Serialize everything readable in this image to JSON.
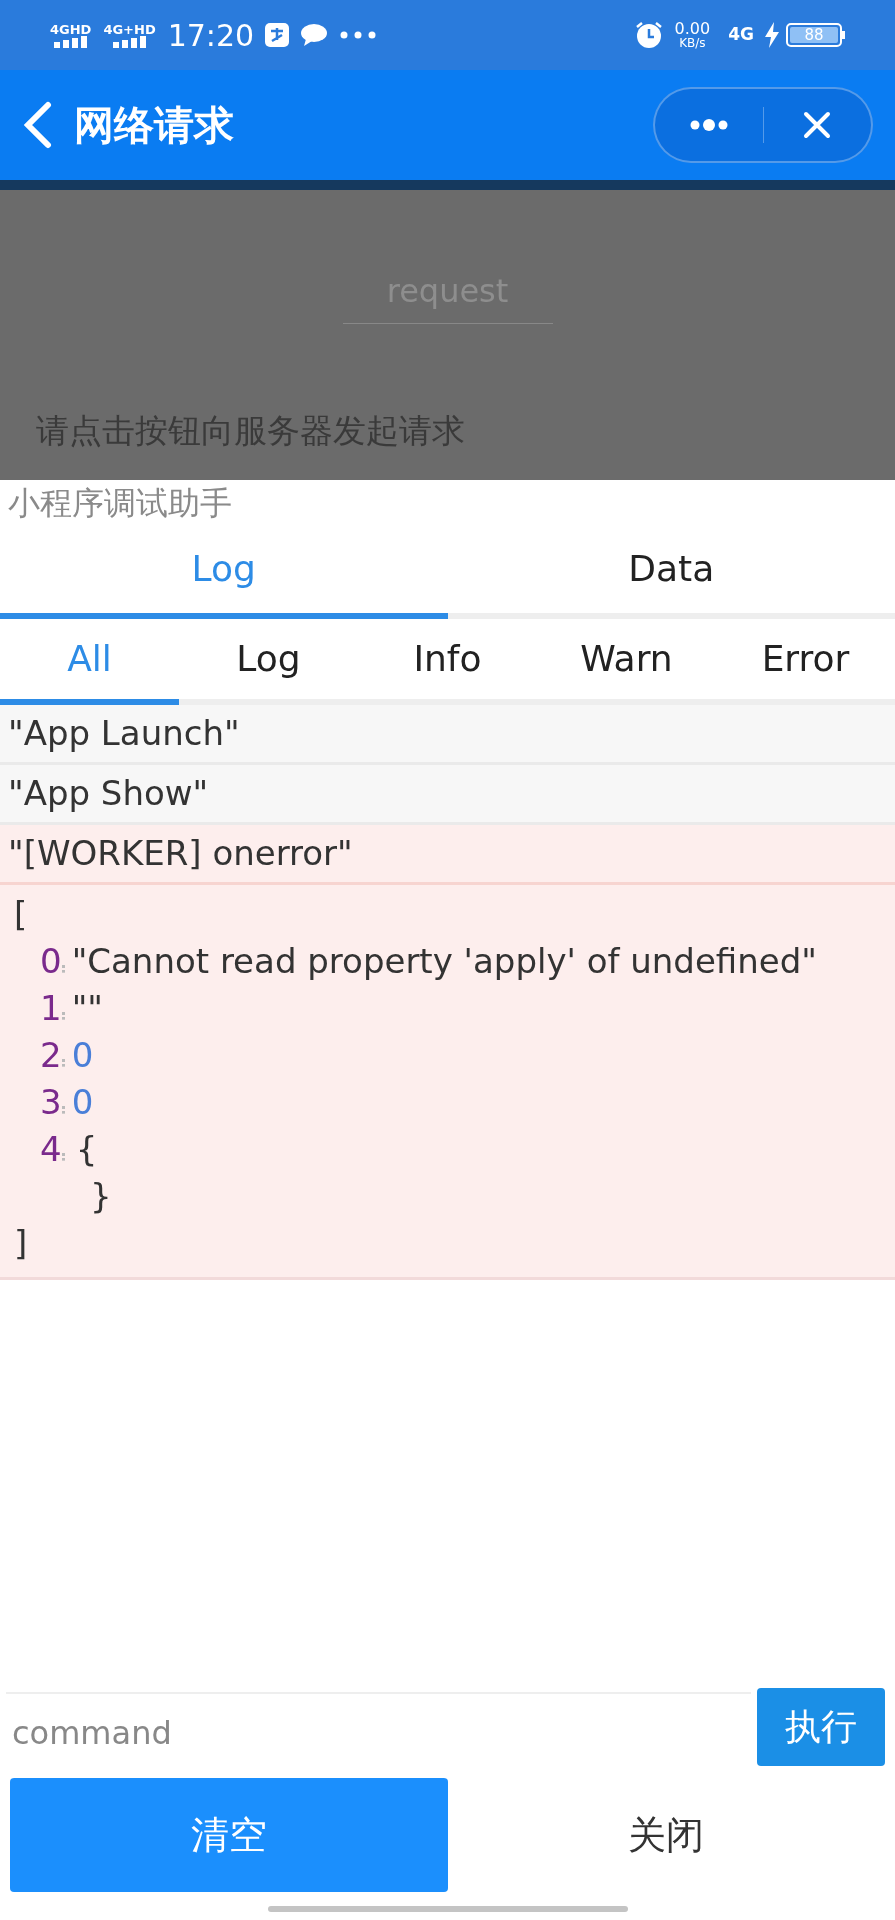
{
  "status_bar": {
    "network_1": "4GHD",
    "network_2": "4G+HD",
    "time": "17:20",
    "speed_value": "0.00",
    "speed_unit": "KB/s",
    "mobile_data": "4G",
    "battery": "88"
  },
  "nav_bar": {
    "title": "网络请求"
  },
  "page": {
    "request_button": "request",
    "hint": "请点击按钮向服务器发起请求"
  },
  "debug_panel": {
    "title": "小程序调试助手",
    "tabs": [
      {
        "label": "Log",
        "selected": true
      },
      {
        "label": "Data",
        "selected": false
      }
    ],
    "filters": [
      {
        "label": "All",
        "selected": true
      },
      {
        "label": "Log",
        "selected": false
      },
      {
        "label": "Info",
        "selected": false
      },
      {
        "label": "Warn",
        "selected": false
      },
      {
        "label": "Error",
        "selected": false
      }
    ],
    "entries": [
      {
        "kind": "log",
        "text": "\"App Launch\""
      },
      {
        "kind": "log",
        "text": "\"App Show\""
      },
      {
        "kind": "error",
        "text": "\"[WORKER] onerror\""
      },
      {
        "kind": "tree",
        "open": "[",
        "close": "]",
        "items": [
          {
            "key": "0",
            "value": "\"Cannot read property 'apply' of undefined\"",
            "kind": "string"
          },
          {
            "key": "1",
            "value": "\"\"",
            "kind": "string"
          },
          {
            "key": "2",
            "value": "0",
            "kind": "number"
          },
          {
            "key": "3",
            "value": "0",
            "kind": "number"
          },
          {
            "key": "4",
            "kind": "object",
            "open": "{",
            "close": "}"
          }
        ]
      }
    ],
    "command": {
      "placeholder": "command",
      "run_button": "执行"
    },
    "buttons": [
      {
        "label": "清空",
        "kind": "primary"
      },
      {
        "label": "关闭",
        "kind": "plain"
      }
    ]
  }
}
